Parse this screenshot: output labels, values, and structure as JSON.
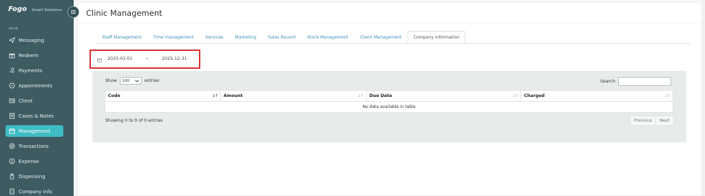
{
  "brand": {
    "logo": "Fogo",
    "subtitle": "Smart Solutions"
  },
  "sidebar": {
    "section_label": "MAIN",
    "items": [
      {
        "label": "Messaging",
        "icon": "send-icon",
        "active": false
      },
      {
        "label": "Redeem",
        "icon": "gift-icon",
        "active": false
      },
      {
        "label": "Payments",
        "icon": "hand-coin-icon",
        "active": false
      },
      {
        "label": "Appointments",
        "icon": "compass-icon",
        "active": false
      },
      {
        "label": "Client",
        "icon": "id-card-icon",
        "active": false
      },
      {
        "label": "Cases & Notes",
        "icon": "notes-icon",
        "active": false
      },
      {
        "label": "Management",
        "icon": "calendar-icon",
        "active": true
      },
      {
        "label": "Transactions",
        "icon": "exchange-icon",
        "active": false
      },
      {
        "label": "Expense",
        "icon": "dollar-circle-icon",
        "active": false
      },
      {
        "label": "Dispensing",
        "icon": "bottle-icon",
        "active": false
      },
      {
        "label": "Company Info",
        "icon": "building-icon",
        "active": false
      }
    ]
  },
  "page": {
    "title": "Clinic Management"
  },
  "tabs": [
    {
      "label": "Staff Management",
      "active": false
    },
    {
      "label": "Time management",
      "active": false
    },
    {
      "label": "Services",
      "active": false
    },
    {
      "label": "Marketing",
      "active": false
    },
    {
      "label": "Sales Record",
      "active": false
    },
    {
      "label": "Stock Management",
      "active": false
    },
    {
      "label": "Client Management",
      "active": false
    },
    {
      "label": "Company Information",
      "active": true
    }
  ],
  "date_range": {
    "start": "2025-01-01",
    "separator": "~",
    "end": "2025-12-31",
    "highlight_color": "#d92b2b"
  },
  "table_controls": {
    "show_label": "Show",
    "page_size": "100",
    "entries_label": "entries",
    "search_label": "Search:",
    "search_value": ""
  },
  "table": {
    "columns": [
      "Code",
      "Amount",
      "Due Date",
      "Charged"
    ],
    "empty_message": "No data available in table",
    "info": "Showing 0 to 0 of 0 entries",
    "previous_label": "Previous",
    "next_label": "Next"
  },
  "colors": {
    "sidebar": "#3d5b61",
    "accent": "#3fbcc4",
    "link": "#3a8bb5"
  }
}
